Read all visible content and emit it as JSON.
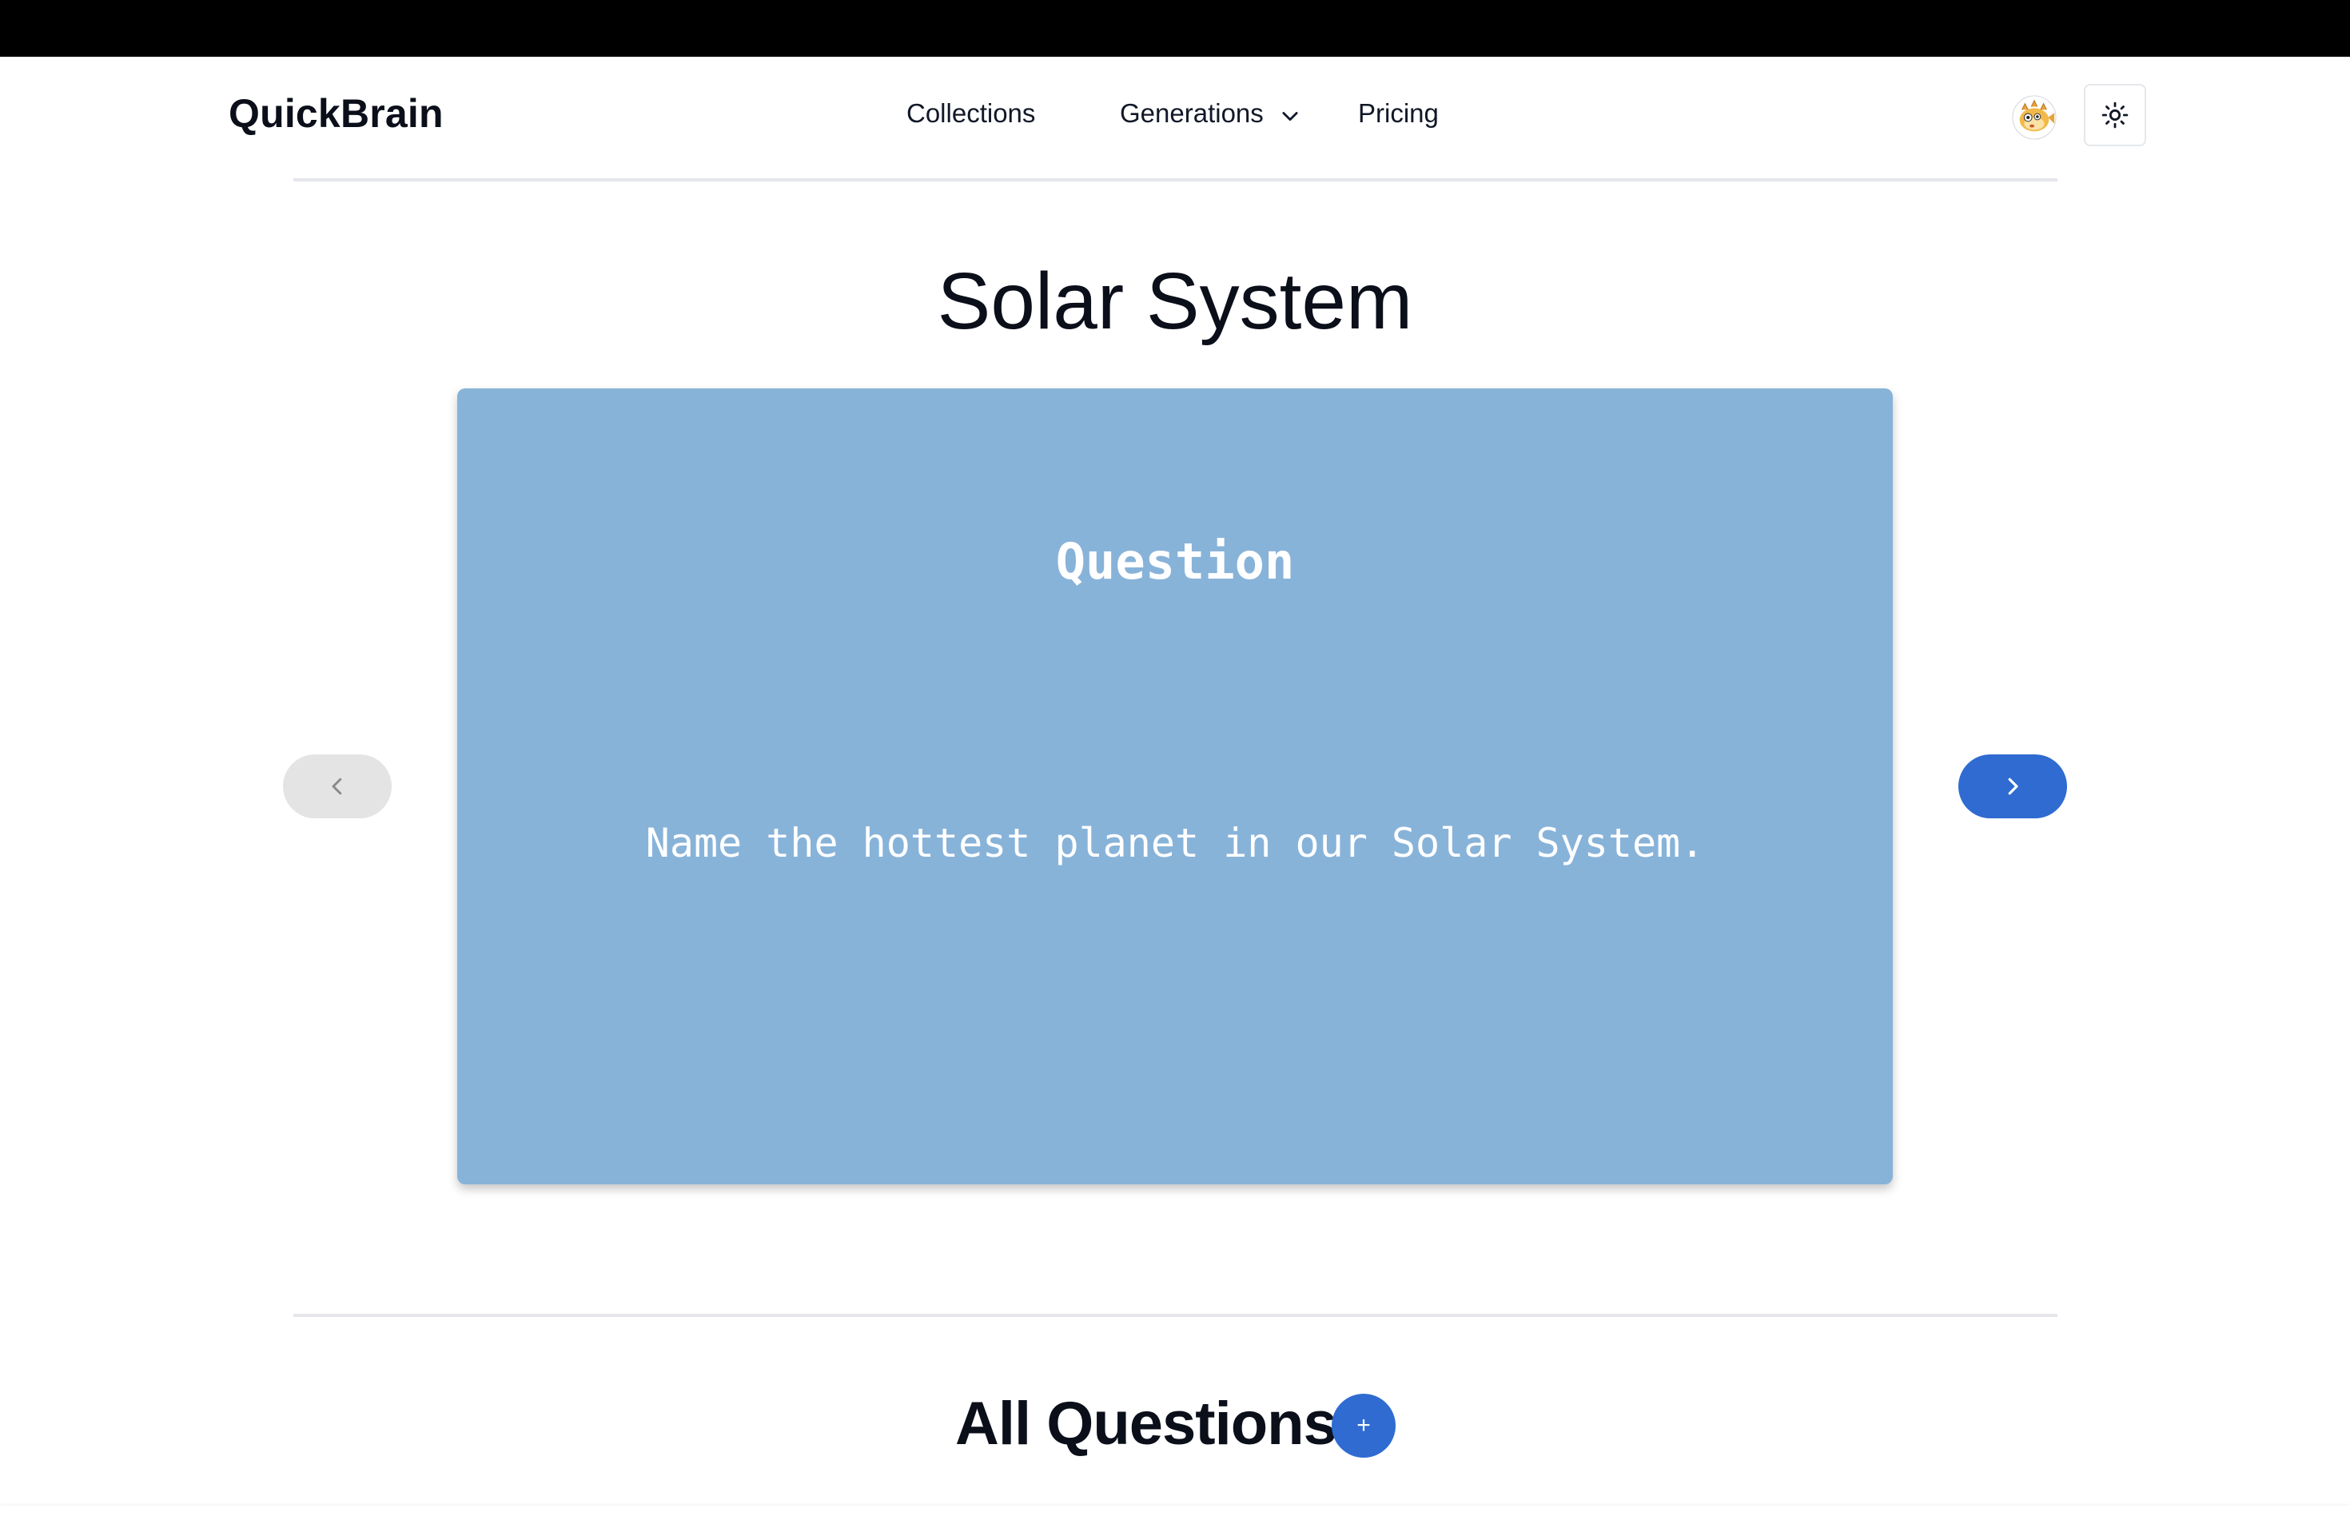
{
  "header": {
    "brand": "QuickBrain",
    "nav": {
      "collections": "Collections",
      "generations": "Generations",
      "pricing": "Pricing"
    },
    "icons": {
      "generations_dropdown": "chevron-down-icon",
      "avatar": "pufferfish-avatar",
      "theme_toggle": "sun-icon"
    }
  },
  "main": {
    "title": "Solar System",
    "card": {
      "heading": "Question",
      "text": "Name the hottest planet in our Solar System.",
      "color": "#88b3d9"
    },
    "prev_icon": "chevron-left-icon",
    "next_icon": "chevron-right-icon",
    "accent_color": "#2f6bd1"
  },
  "questions": {
    "title": "All Questions",
    "add_label": "+"
  }
}
